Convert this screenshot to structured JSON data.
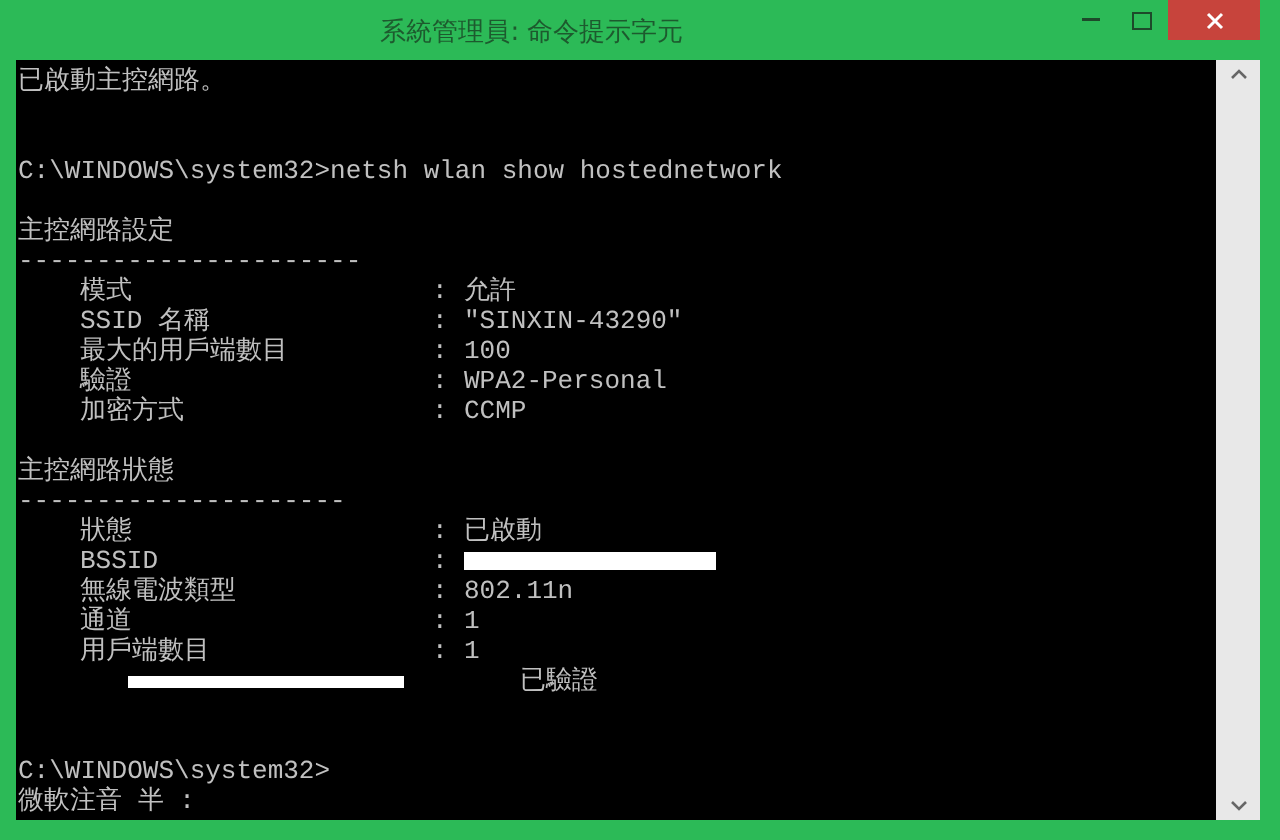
{
  "window": {
    "title": "系統管理員: 命令提示字元"
  },
  "console": [
    {
      "kind": "text",
      "text": "已啟動主控網路。"
    },
    {
      "kind": "blank"
    },
    {
      "kind": "blank"
    },
    {
      "kind": "text",
      "text": "C:\\WINDOWS\\system32>netsh wlan show hostednetwork"
    },
    {
      "kind": "blank"
    },
    {
      "kind": "text",
      "text": "主控網路設定"
    },
    {
      "kind": "text",
      "text": "----------------------"
    },
    {
      "kind": "row",
      "label": "模式",
      "separator": ":",
      "value": "允許"
    },
    {
      "kind": "row",
      "label": "SSID 名稱",
      "separator": ":",
      "value": "\"SINXIN-43290\""
    },
    {
      "kind": "row",
      "label": "最大的用戶端數目",
      "separator": ":",
      "value": "100"
    },
    {
      "kind": "row",
      "label": "驗證",
      "separator": ":",
      "value": "WPA2-Personal"
    },
    {
      "kind": "row",
      "label": "加密方式",
      "separator": ":",
      "value": "CCMP"
    },
    {
      "kind": "blank"
    },
    {
      "kind": "text",
      "text": "主控網路狀態"
    },
    {
      "kind": "text",
      "text": "---------------------"
    },
    {
      "kind": "row",
      "label": "狀態",
      "separator": ":",
      "value": "已啟動"
    },
    {
      "kind": "row",
      "label": "BSSID",
      "separator": ":",
      "redacted": true
    },
    {
      "kind": "row",
      "label": "無線電波類型",
      "separator": ":",
      "value": "802.11n"
    },
    {
      "kind": "row",
      "label": "通道",
      "separator": ":",
      "value": "1"
    },
    {
      "kind": "row",
      "label": "用戶端數目",
      "separator": ":",
      "value": "1"
    },
    {
      "kind": "client",
      "status": "已驗證",
      "redacted": true
    },
    {
      "kind": "blank"
    },
    {
      "kind": "blank"
    },
    {
      "kind": "text",
      "text": "C:\\WINDOWS\\system32>"
    },
    {
      "kind": "text",
      "text": "微軟注音 半 :"
    }
  ]
}
